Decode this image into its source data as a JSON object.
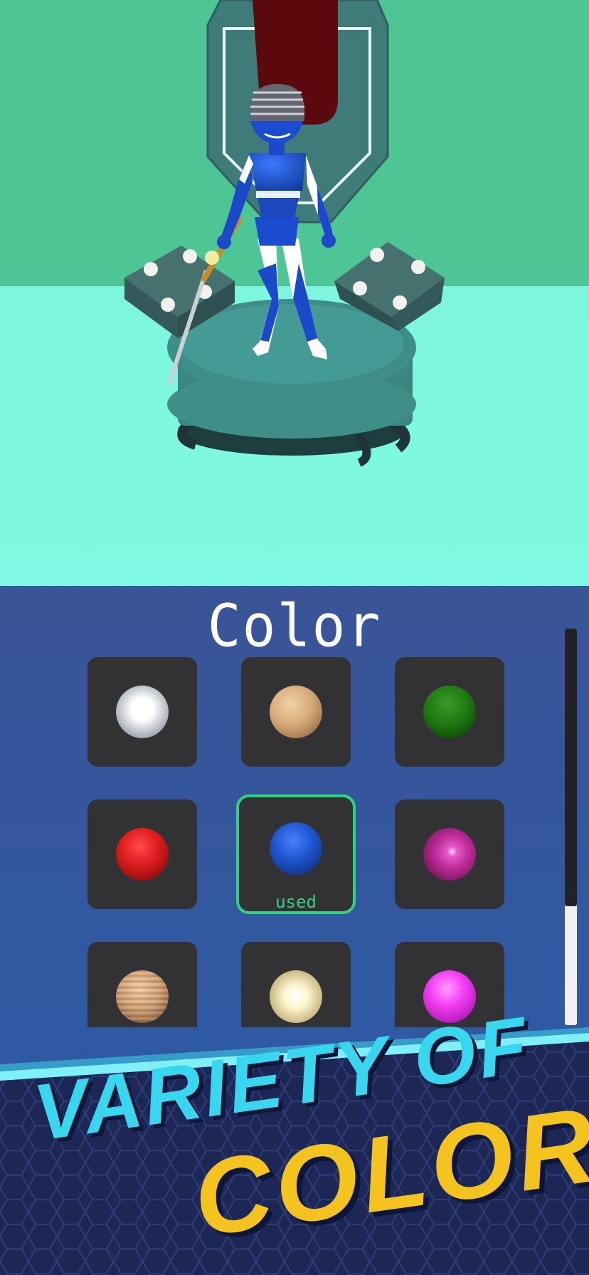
{
  "panel": {
    "title": "Color",
    "swatches": [
      {
        "id": "white",
        "color": "#f4f6f8",
        "dark": "#7e8893",
        "used": false
      },
      {
        "id": "wood",
        "color": "#d7ab78",
        "dark": "#7d5534",
        "used": false
      },
      {
        "id": "dark-green",
        "color": "#1f7a12",
        "dark": "#0b3306",
        "used": false
      },
      {
        "id": "red",
        "color": "#e01e1e",
        "dark": "#6a0707",
        "used": false
      },
      {
        "id": "blue",
        "color": "#1f57d0",
        "dark": "#0a2466",
        "used": true
      },
      {
        "id": "purple",
        "color": "#bf2c9a",
        "dark": "#4b0d3c",
        "used": false
      },
      {
        "id": "pixel-tan",
        "color": "#d7a275",
        "dark": "#6e4a2c",
        "used": false
      },
      {
        "id": "pearl",
        "color": "#fff6d2",
        "dark": "#9b8f64",
        "used": false
      },
      {
        "id": "magenta",
        "color": "#f23cf2",
        "dark": "#8d0a95",
        "used": false
      }
    ],
    "used_label": "used",
    "scroll_position": 0
  },
  "banner": {
    "line1": "VARIETY OF",
    "line2": "COLORS",
    "line1_color": "#39d6f0",
    "line2_color": "#f5c31e"
  },
  "colors": {
    "sky": "#4ec594",
    "floor": "#7ff7e0",
    "pedestal": "#3d8c86",
    "accent": "#2fd27e"
  }
}
